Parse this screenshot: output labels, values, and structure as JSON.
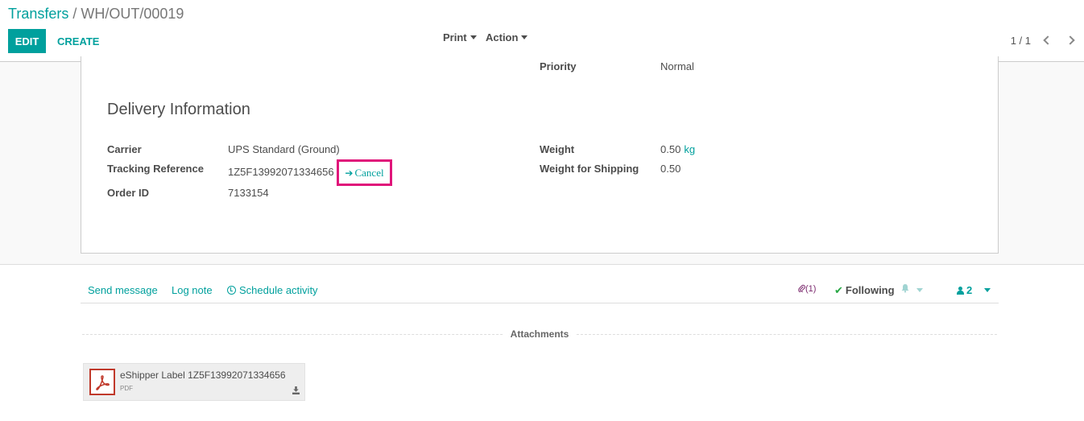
{
  "breadcrumb": {
    "parent": "Transfers",
    "separator": "/",
    "current": "WH/OUT/00019"
  },
  "toolbar": {
    "edit_label": "EDIT",
    "create_label": "CREATE",
    "print_label": "Print",
    "action_label": "Action"
  },
  "pager": {
    "value": "1 / 1"
  },
  "form": {
    "priority_label": "Priority",
    "priority_value": "Normal",
    "section_title": "Delivery Information",
    "carrier_label": "Carrier",
    "carrier_value": "UPS Standard (Ground)",
    "tracking_label": "Tracking Reference",
    "tracking_value": "1Z5F13992071334656",
    "cancel_label": "Cancel",
    "order_label": "Order ID",
    "order_value": "7133154",
    "weight_label": "Weight",
    "weight_value": "0.50",
    "weight_unit": "kg",
    "shipping_weight_label": "Weight for Shipping",
    "shipping_weight_value": "0.50"
  },
  "chatter": {
    "send_message": "Send message",
    "log_note": "Log note",
    "schedule_activity": "Schedule activity",
    "attachment_count": "(1)",
    "following": "Following",
    "followers_count": "2",
    "attachments_title": "Attachments"
  },
  "attachment": {
    "name": "eShipper Label 1Z5F13992071334656",
    "type": "PDF"
  },
  "colors": {
    "accent": "#00a09d",
    "highlight": "#e0157a",
    "pdf_red": "#c0392b"
  },
  "icons": [
    "chevron-left-icon",
    "chevron-right-icon",
    "arrow-right-icon",
    "clock-icon",
    "paperclip-icon",
    "check-icon",
    "bell-icon",
    "user-icon",
    "pdf-icon",
    "download-icon"
  ]
}
